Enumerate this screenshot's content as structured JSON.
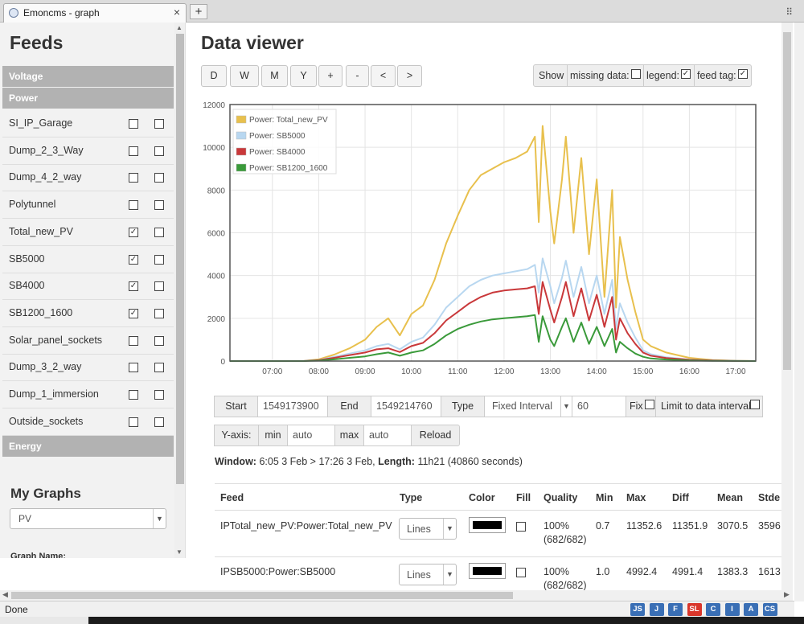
{
  "browser": {
    "tab_title": "Emoncms - graph",
    "tab_close": "×",
    "new_tab": "+",
    "grip": "⠿",
    "status": "Done",
    "badges": [
      {
        "label": "JS",
        "color": "#3a6fb5"
      },
      {
        "label": "J",
        "color": "#3a6fb5"
      },
      {
        "label": "F",
        "color": "#3a6fb5"
      },
      {
        "label": "SL",
        "color": "#d9362b"
      },
      {
        "label": "C",
        "color": "#3a6fb5"
      },
      {
        "label": "I",
        "color": "#3a6fb5"
      },
      {
        "label": "A",
        "color": "#3a6fb5"
      },
      {
        "label": "CS",
        "color": "#3a6fb5"
      }
    ]
  },
  "sidebar": {
    "title": "Feeds",
    "groups": {
      "voltage": "Voltage",
      "power": "Power",
      "energy": "Energy"
    },
    "feeds": [
      {
        "name": "SI_IP_Garage",
        "left": "",
        "right": ""
      },
      {
        "name": "Dump_2_3_Way",
        "left": "",
        "right": ""
      },
      {
        "name": "Dump_4_2_way",
        "left": "",
        "right": ""
      },
      {
        "name": "Polytunnel",
        "left": "",
        "right": ""
      },
      {
        "name": "Total_new_PV",
        "left": "✓",
        "right": ""
      },
      {
        "name": "SB5000",
        "left": "✓",
        "right": ""
      },
      {
        "name": "SB4000",
        "left": "✓",
        "right": ""
      },
      {
        "name": "SB1200_1600",
        "left": "✓",
        "right": ""
      },
      {
        "name": "Solar_panel_sockets",
        "left": "",
        "right": ""
      },
      {
        "name": "Dump_3_2_way",
        "left": "",
        "right": ""
      },
      {
        "name": "Dump_1_immersion",
        "left": "",
        "right": ""
      },
      {
        "name": "Outside_sockets",
        "left": "",
        "right": ""
      }
    ],
    "my_graphs": "My Graphs",
    "graph_select": "PV",
    "graph_name_label": "Graph Name:",
    "scroll_up": "▲",
    "scroll_down": "▼"
  },
  "viewer": {
    "title": "Data viewer",
    "range_buttons": [
      "D",
      "W",
      "M",
      "Y",
      "+",
      "-",
      "<",
      ">"
    ],
    "show_label": "Show",
    "missing_data_label": "missing data:",
    "missing_data_checked": "",
    "legend_label": "legend:",
    "legend_checked": "✓",
    "feed_tag_label": "feed tag:",
    "feed_tag_checked": "✓"
  },
  "controls": {
    "start_label": "Start",
    "start_value": "1549173900",
    "end_label": "End",
    "end_value": "1549214760",
    "type_label": "Type",
    "type_value": "Fixed Interval",
    "interval_value": "60",
    "fix_label": "Fix",
    "fix_checked": "",
    "limit_label": "Limit to data interval",
    "limit_checked": "",
    "yaxis_label": "Y-axis:",
    "min_label": "min",
    "min_value": "auto",
    "max_label": "max",
    "max_value": "auto",
    "reload_label": "Reload"
  },
  "window_info": {
    "window_label": "Window:",
    "window_value": "6:05 3 Feb > 17:26 3 Feb,",
    "length_label": "Length:",
    "length_value": "11h21 (40860 seconds)"
  },
  "table": {
    "headers": [
      "Feed",
      "Type",
      "Color",
      "Fill",
      "Quality",
      "Min",
      "Max",
      "Diff",
      "Mean",
      "Stde"
    ],
    "rows": [
      {
        "feed": "IPTotal_new_PV:Power:Total_new_PV",
        "type": "Lines",
        "color": "#000000",
        "fill": "",
        "quality": "100%",
        "quality2": "(682/682)",
        "min": "0.7",
        "max": "11352.6",
        "diff": "11351.9",
        "mean": "3070.5",
        "stdev": "3596"
      },
      {
        "feed": "IPSB5000:Power:SB5000",
        "type": "Lines",
        "color": "#000000",
        "fill": "",
        "quality": "100%",
        "quality2": "(682/682)",
        "min": "1.0",
        "max": "4992.4",
        "diff": "4991.4",
        "mean": "1383.3",
        "stdev": "1613"
      }
    ]
  },
  "chart_data": {
    "type": "line",
    "title": "",
    "xlabel": "",
    "ylabel": "",
    "ylim": [
      0,
      12000
    ],
    "y_ticks": [
      "0",
      "2000",
      "4000",
      "6000",
      "8000",
      "10000",
      "12000"
    ],
    "x_ticks": [
      "07:00",
      "08:00",
      "09:00",
      "10:00",
      "11:00",
      "12:00",
      "13:00",
      "14:00",
      "15:00",
      "16:00",
      "17:00"
    ],
    "x_range": [
      "06:05",
      "17:26"
    ],
    "grid": true,
    "legend_position": "top-left",
    "series": [
      {
        "name": "Power: Total_new_PV",
        "color": "#e8c04d",
        "x": [
          "06:05",
          "07:00",
          "07:40",
          "08:00",
          "08:20",
          "08:40",
          "09:00",
          "09:15",
          "09:30",
          "09:45",
          "10:00",
          "10:15",
          "10:30",
          "10:45",
          "11:00",
          "11:15",
          "11:30",
          "11:45",
          "12:00",
          "12:15",
          "12:30",
          "12:40",
          "12:45",
          "12:50",
          "13:00",
          "13:05",
          "13:15",
          "13:20",
          "13:30",
          "13:40",
          "13:50",
          "14:00",
          "14:10",
          "14:20",
          "14:25",
          "14:30",
          "14:40",
          "14:50",
          "15:00",
          "15:10",
          "15:30",
          "16:00",
          "16:30",
          "17:00",
          "17:26"
        ],
        "values": [
          0,
          0,
          0,
          80,
          300,
          600,
          1000,
          1600,
          2000,
          1200,
          2200,
          2600,
          3800,
          5500,
          6800,
          8000,
          8700,
          9000,
          9300,
          9500,
          9800,
          10500,
          6500,
          11000,
          7000,
          5500,
          8500,
          10500,
          6000,
          9500,
          5000,
          8500,
          3000,
          8000,
          2500,
          5800,
          3800,
          2300,
          1000,
          700,
          400,
          150,
          50,
          10,
          0
        ]
      },
      {
        "name": "Power: SB5000",
        "color": "#b8d7f0",
        "x": [
          "06:05",
          "07:00",
          "07:40",
          "08:00",
          "08:20",
          "08:40",
          "09:00",
          "09:15",
          "09:30",
          "09:45",
          "10:00",
          "10:15",
          "10:30",
          "10:45",
          "11:00",
          "11:15",
          "11:30",
          "11:45",
          "12:00",
          "12:15",
          "12:30",
          "12:40",
          "12:45",
          "12:50",
          "13:00",
          "13:05",
          "13:15",
          "13:20",
          "13:30",
          "13:40",
          "13:50",
          "14:00",
          "14:10",
          "14:20",
          "14:25",
          "14:30",
          "14:40",
          "14:50",
          "15:00",
          "15:10",
          "15:30",
          "16:00",
          "16:30",
          "17:00",
          "17:26"
        ],
        "values": [
          0,
          0,
          0,
          50,
          200,
          350,
          500,
          700,
          800,
          550,
          900,
          1100,
          1700,
          2500,
          3000,
          3500,
          3800,
          4000,
          4100,
          4200,
          4300,
          4500,
          3200,
          4800,
          3500,
          2700,
          3900,
          4700,
          3000,
          4400,
          2700,
          4000,
          2200,
          3800,
          1500,
          2700,
          1800,
          1100,
          500,
          320,
          180,
          70,
          30,
          5,
          0
        ]
      },
      {
        "name": "Power: SB4000",
        "color": "#c9383a",
        "x": [
          "06:05",
          "07:00",
          "07:40",
          "08:00",
          "08:20",
          "08:40",
          "09:00",
          "09:15",
          "09:30",
          "09:45",
          "10:00",
          "10:15",
          "10:30",
          "10:45",
          "11:00",
          "11:15",
          "11:30",
          "11:45",
          "12:00",
          "12:15",
          "12:30",
          "12:40",
          "12:45",
          "12:50",
          "13:00",
          "13:05",
          "13:15",
          "13:20",
          "13:30",
          "13:40",
          "13:50",
          "14:00",
          "14:10",
          "14:20",
          "14:25",
          "14:30",
          "14:40",
          "14:50",
          "15:00",
          "15:10",
          "15:30",
          "16:00",
          "16:30",
          "17:00",
          "17:26"
        ],
        "values": [
          0,
          0,
          0,
          40,
          150,
          280,
          400,
          550,
          600,
          420,
          700,
          850,
          1300,
          1900,
          2300,
          2700,
          3000,
          3200,
          3300,
          3350,
          3400,
          3500,
          2200,
          3700,
          2400,
          1800,
          3000,
          3700,
          2100,
          3400,
          1900,
          3100,
          1600,
          3000,
          1000,
          2000,
          1300,
          800,
          400,
          250,
          140,
          60,
          25,
          5,
          0
        ]
      },
      {
        "name": "Power: SB1200_1600",
        "color": "#3a9a3a",
        "x": [
          "06:05",
          "07:00",
          "07:40",
          "08:00",
          "08:20",
          "08:40",
          "09:00",
          "09:15",
          "09:30",
          "09:45",
          "10:00",
          "10:15",
          "10:30",
          "10:45",
          "11:00",
          "11:15",
          "11:30",
          "11:45",
          "12:00",
          "12:15",
          "12:30",
          "12:40",
          "12:45",
          "12:50",
          "13:00",
          "13:05",
          "13:15",
          "13:20",
          "13:30",
          "13:40",
          "13:50",
          "14:00",
          "14:10",
          "14:20",
          "14:25",
          "14:30",
          "14:40",
          "14:50",
          "15:00",
          "15:10",
          "15:30",
          "16:00",
          "16:30",
          "17:00",
          "17:26"
        ],
        "values": [
          0,
          0,
          0,
          20,
          80,
          150,
          220,
          320,
          400,
          250,
          400,
          500,
          800,
          1200,
          1500,
          1700,
          1850,
          1950,
          2000,
          2050,
          2100,
          2150,
          900,
          2100,
          1000,
          700,
          1600,
          2000,
          900,
          1800,
          800,
          1600,
          700,
          1500,
          400,
          900,
          600,
          350,
          200,
          120,
          70,
          30,
          10,
          2,
          0
        ]
      }
    ]
  }
}
